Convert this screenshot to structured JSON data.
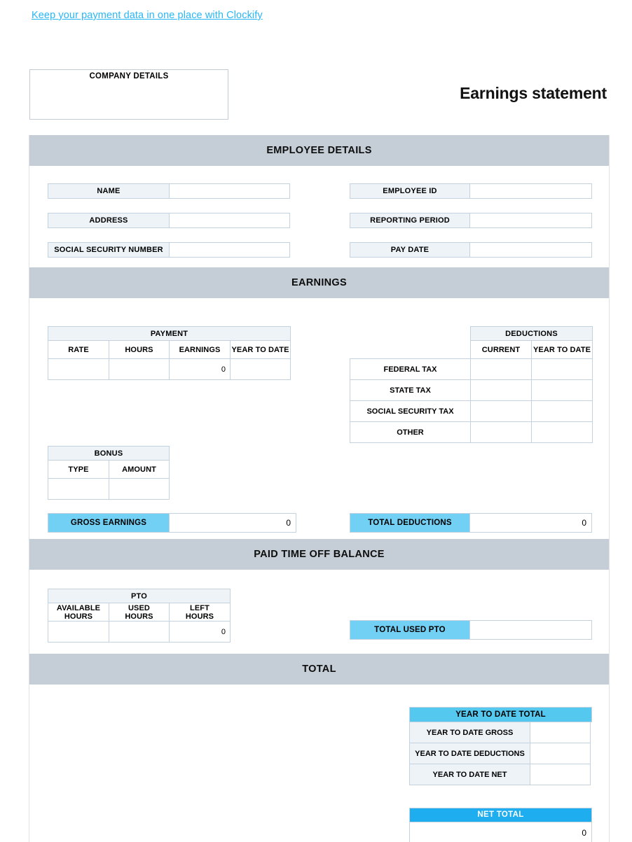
{
  "promo": {
    "link_text": "Keep your payment data in one place with Clockify"
  },
  "company_box": {
    "title": "COMPANY DETAILS"
  },
  "document": {
    "title": "Earnings statement"
  },
  "sections": {
    "employee_details": "EMPLOYEE DETAILS",
    "earnings": "EARNINGS",
    "pto_balance": "PAID TIME OFF BALANCE",
    "total": "TOTAL"
  },
  "employee": {
    "left": [
      {
        "label": "NAME",
        "value": ""
      },
      {
        "label": "ADDRESS",
        "value": ""
      },
      {
        "label": "SOCIAL SECURITY NUMBER",
        "value": ""
      }
    ],
    "right": [
      {
        "label": "EMPLOYEE ID",
        "value": ""
      },
      {
        "label": "REPORTING PERIOD",
        "value": ""
      },
      {
        "label": "PAY DATE",
        "value": ""
      }
    ]
  },
  "payment": {
    "group_header": "PAYMENT",
    "columns": [
      "RATE",
      "HOURS",
      "EARNINGS",
      "YEAR TO DATE"
    ],
    "rows": [
      {
        "rate": "",
        "hours": "",
        "earnings": "0",
        "year_to_date": ""
      }
    ]
  },
  "deductions": {
    "group_header": "DEDUCTIONS",
    "columns": [
      "CURRENT",
      "YEAR TO DATE"
    ],
    "rows": [
      {
        "label": "FEDERAL TAX",
        "current": "",
        "year_to_date": ""
      },
      {
        "label": "STATE TAX",
        "current": "",
        "year_to_date": ""
      },
      {
        "label": "SOCIAL SECURITY TAX",
        "current": "",
        "year_to_date": ""
      },
      {
        "label": "OTHER",
        "current": "",
        "year_to_date": ""
      }
    ]
  },
  "bonus": {
    "group_header": "BONUS",
    "columns": [
      "TYPE",
      "AMOUNT"
    ],
    "rows": [
      {
        "type": "",
        "amount": ""
      }
    ]
  },
  "gross_earnings": {
    "label": "GROSS EARNINGS",
    "value": "0"
  },
  "total_deductions": {
    "label": "TOTAL DEDUCTIONS",
    "value": "0"
  },
  "pto": {
    "group_header": "PTO",
    "columns": [
      "AVAILABLE HOURS",
      "USED HOURS",
      "LEFT HOURS"
    ],
    "col_line1": [
      "AVAILABLE",
      "USED",
      "LEFT"
    ],
    "col_line2": [
      "HOURS",
      "HOURS",
      "HOURS"
    ],
    "rows": [
      {
        "available": "",
        "used": "",
        "left": "0"
      }
    ]
  },
  "total_used_pto": {
    "label": "TOTAL USED PTO",
    "value": ""
  },
  "year_to_date_total": {
    "header": "YEAR TO DATE TOTAL",
    "rows": [
      {
        "label": "YEAR TO DATE GROSS",
        "value": ""
      },
      {
        "label": "YEAR TO DATE DEDUCTIONS",
        "value": ""
      },
      {
        "label": "YEAR TO DATE NET",
        "value": ""
      }
    ]
  },
  "net_total": {
    "header": "NET TOTAL",
    "value": "0"
  },
  "colors": {
    "link": "#29b6f6",
    "band": "#c5ced6",
    "label_fill": "#eef3f7",
    "total_blue": "#72d0f4",
    "ytd_blue": "#55c8f0",
    "net_blue": "#1eaef0",
    "border": "#c3d2de"
  }
}
